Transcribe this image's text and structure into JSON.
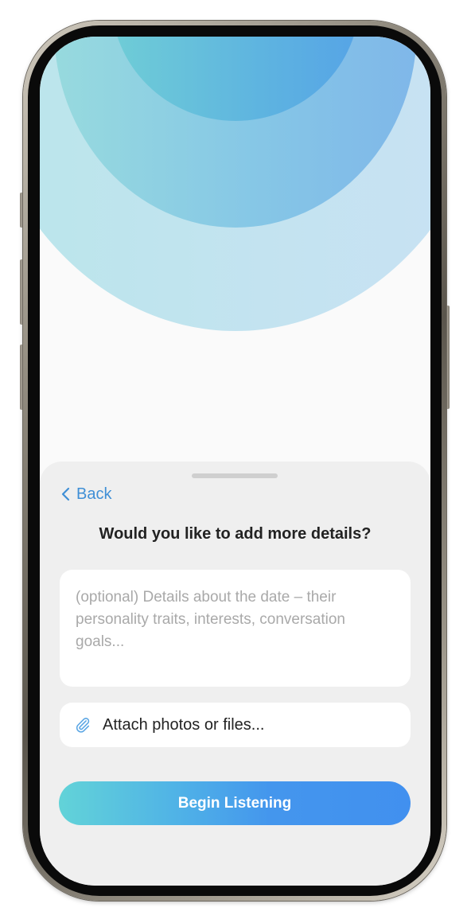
{
  "sheet": {
    "back_label": "Back",
    "title": "Would you like to add more details?",
    "details": {
      "placeholder": "(optional) Details about the date – their personality traits, interests, conversation goals..."
    },
    "attach": {
      "label": "Attach photos or files...",
      "icon": "paperclip-icon"
    },
    "primary_button": {
      "label": "Begin Listening"
    }
  },
  "colors": {
    "accent_blue": "#3f8fd6",
    "button_gradient_start": "#62d3d8",
    "button_gradient_end": "#4190ef",
    "sheet_background": "#efefef"
  }
}
